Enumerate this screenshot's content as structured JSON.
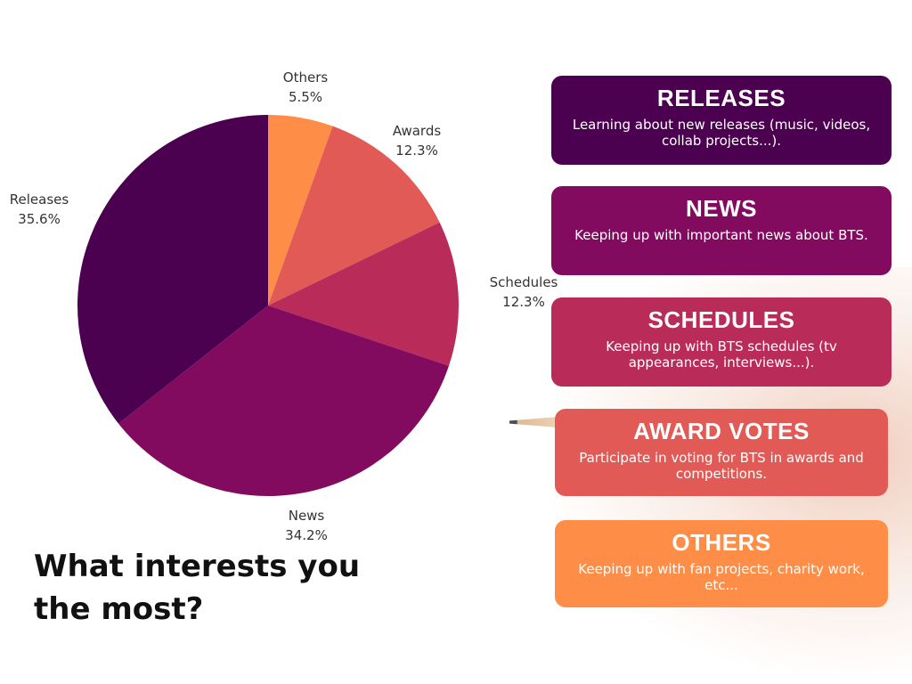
{
  "title": "What interests you the most?",
  "colors": {
    "releases": "#4c0050",
    "news": "#830b5f",
    "schedules": "#b92b59",
    "awards": "#e15a55",
    "others": "#fd8d47"
  },
  "chart_data": {
    "type": "pie",
    "title": "What interests you the most?",
    "slices": [
      {
        "label": "Others",
        "percent_label": "5.5%",
        "value": 5.5,
        "color": "#fd8d47"
      },
      {
        "label": "Awards",
        "percent_label": "12.3%",
        "value": 12.3,
        "color": "#e15a55"
      },
      {
        "label": "Schedules",
        "percent_label": "12.3%",
        "value": 12.3,
        "color": "#b92b59"
      },
      {
        "label": "News",
        "percent_label": "34.2%",
        "value": 34.2,
        "color": "#830b5f"
      },
      {
        "label": "Releases",
        "percent_label": "35.6%",
        "value": 35.6,
        "color": "#4c0050"
      }
    ],
    "start": "12 o'clock",
    "direction": "clockwise",
    "legend": "right"
  },
  "cards": [
    {
      "heading": "RELEASES",
      "description": "Learning about new releases (music, videos, collab projects...).",
      "color": "#4c0050"
    },
    {
      "heading": "NEWS",
      "description": "Keeping up with important news about BTS.",
      "color": "#830b5f"
    },
    {
      "heading": "SCHEDULES",
      "description": "Keeping up with BTS schedules (tv appearances, interviews...).",
      "color": "#b92b59"
    },
    {
      "heading": "AWARD VOTES",
      "description": "Participate in voting for BTS in awards and competitions.",
      "color": "#e15a55"
    },
    {
      "heading": "OTHERS",
      "description": "Keeping up with fan projects, charity work, etc...",
      "color": "#fd8d47"
    }
  ]
}
